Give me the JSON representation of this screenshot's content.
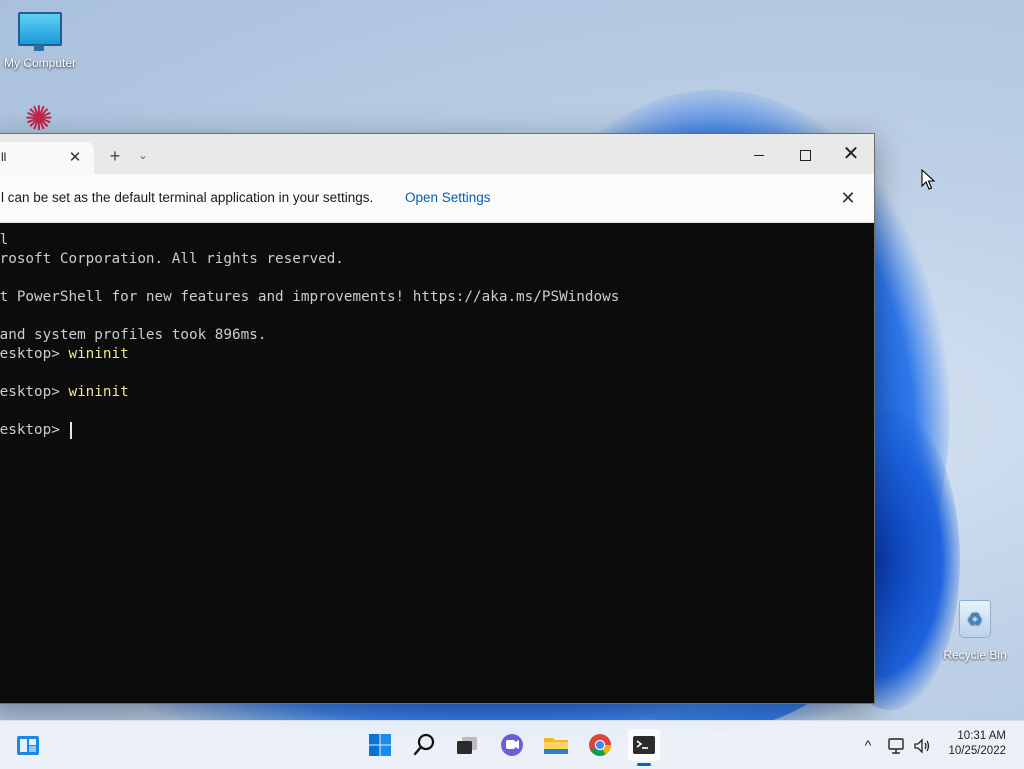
{
  "desktop": {
    "icons": [
      {
        "label": "My Computer"
      },
      {
        "label": "Recycle Bin"
      }
    ]
  },
  "terminal": {
    "tab_title": "ll",
    "tab_close_glyph": "✕",
    "new_tab_glyph": "+",
    "dropdown_glyph": "⌄",
    "close_glyph": "✕",
    "infobar": {
      "message": "l can be set as the default terminal application in your settings.",
      "link": "Open Settings",
      "close_glyph": "✕"
    },
    "lines": [
      {
        "text": "ll",
        "cmd": ""
      },
      {
        "text": "crosoft Corporation. All rights reserved.",
        "cmd": ""
      },
      {
        "text": "",
        "cmd": ""
      },
      {
        "text": "st PowerShell for new features and improvements! https://aka.ms/PSWindows",
        "cmd": ""
      },
      {
        "text": "",
        "cmd": ""
      },
      {
        "text": " and system profiles took 896ms.",
        "cmd": ""
      },
      {
        "text": "Desktop> ",
        "cmd": "wininit"
      },
      {
        "text": "",
        "cmd": ""
      },
      {
        "text": "Desktop> ",
        "cmd": "wininit"
      },
      {
        "text": "",
        "cmd": ""
      },
      {
        "text": "Desktop> ",
        "cmd": ""
      }
    ]
  },
  "taskbar": {
    "apps": [
      {
        "name": "widgets-icon"
      },
      {
        "name": "start-icon"
      },
      {
        "name": "search-icon"
      },
      {
        "name": "task-view-icon"
      },
      {
        "name": "chat-icon"
      },
      {
        "name": "file-explorer-icon"
      },
      {
        "name": "chrome-icon"
      },
      {
        "name": "terminal-icon",
        "active": true
      }
    ],
    "tray": {
      "chevron": "^",
      "time": "10:31 AM",
      "date": "10/25/2022"
    }
  },
  "colors": {
    "accent": "#0067c0",
    "link": "#005fb8",
    "console_bg": "#0c0c0c",
    "console_text": "#cccccc",
    "command_text": "#f0e68c"
  }
}
